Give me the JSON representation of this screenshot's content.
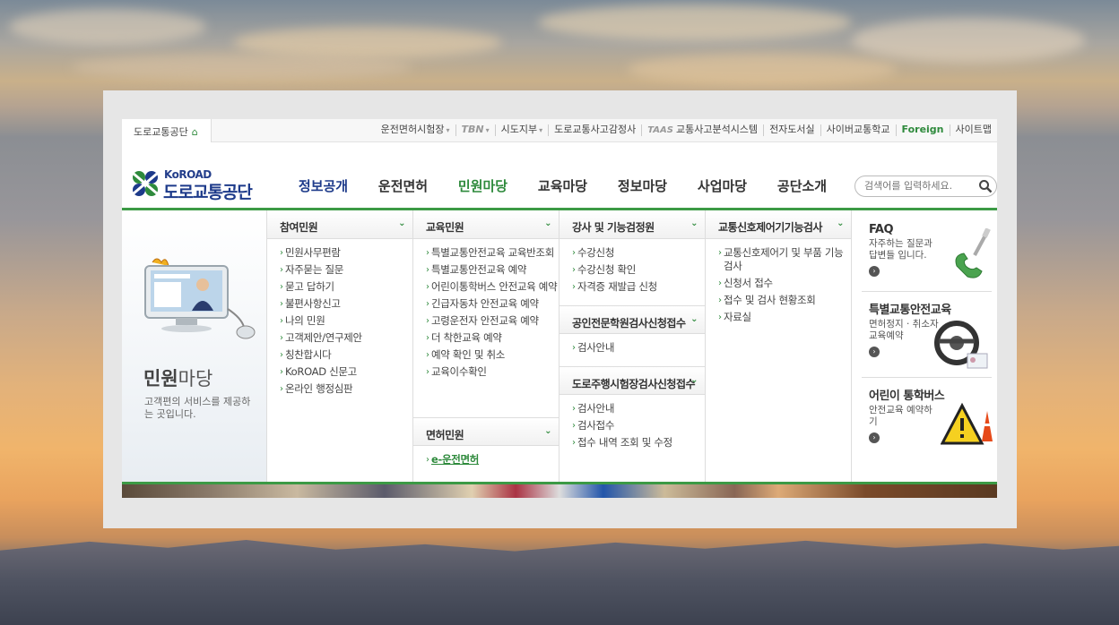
{
  "topbar": {
    "home_label": "도로교통공단",
    "links": [
      {
        "label": "운전면허시험장",
        "dropdown": true
      },
      {
        "label": "TBN",
        "dropdown": true
      },
      {
        "label": "시도지부",
        "dropdown": true
      },
      {
        "label": "도로교통사고감정사",
        "dropdown": false
      },
      {
        "prefix": "TAAS",
        "label": "교통사고분석시스템",
        "dropdown": false
      },
      {
        "label": "전자도서실",
        "dropdown": false
      },
      {
        "label": "사이버교통학교",
        "dropdown": false
      },
      {
        "label": "Foreign",
        "dropdown": false
      },
      {
        "label": "사이트맵",
        "dropdown": false
      }
    ]
  },
  "logo": {
    "en": "KoROAD",
    "kr": "도로교통공단"
  },
  "gnb": [
    "정보공개",
    "운전면허",
    "민원마당",
    "교육마당",
    "정보마당",
    "사업마당",
    "공단소개"
  ],
  "search": {
    "placeholder": "검색어를 입력하세요."
  },
  "intro": {
    "title_bold": "민원",
    "title_light": "마당",
    "desc": "고객편의 서비스를 제공하는 곳입니다."
  },
  "columns": [
    {
      "head": "참여민원",
      "items": [
        "민원사무편람",
        "자주묻는 질문",
        "묻고 답하기",
        "불편사항신고",
        "나의 민원",
        "고객제안/연구제안",
        "칭찬합시다",
        "KoROAD 신문고",
        "온라인 행정심판"
      ]
    },
    {
      "head": "교육민원",
      "items": [
        "특별교통안전교육 교육반조회",
        "특별교통안전교육 예약",
        "어린이통학버스 안전교육 예약",
        "긴급자동차 안전교육 예약",
        "고령운전자 안전교육 예약",
        "더 착한교육 예약",
        "예약 확인 및 취소",
        "교육이수확인"
      ],
      "sub": {
        "head": "면허민원",
        "items": [
          "e-운전면허"
        ]
      }
    },
    {
      "head": "강사 및 기능검정원",
      "items": [
        "수강신청",
        "수강신청 확인",
        "자격증 재발급 신청"
      ],
      "subs": [
        {
          "head": "공인전문학원검사신청접수",
          "items": [
            "검사안내"
          ]
        },
        {
          "head": "도로주행시험장검사신청접수",
          "items": [
            "검사안내",
            "검사접수",
            "접수 내역 조회 및 수정"
          ]
        }
      ]
    },
    {
      "head": "교통신호제어기기능검사",
      "items": [
        "교통신호제어기 및 부품 기능검사",
        "신청서 접수",
        "접수 및 검사 현황조회",
        "자료실"
      ]
    }
  ],
  "promos": [
    {
      "title": "FAQ",
      "desc": "자주하는 질문과 답변들 입니다."
    },
    {
      "title": "특별교통안전교육",
      "desc": "면허정지 · 취소자 교육예약"
    },
    {
      "title": "어린이 통학버스",
      "desc": "안전교육 예약하기"
    }
  ],
  "colors": {
    "brand_green": "#3c9a45",
    "brand_navy": "#1d3a8a"
  }
}
